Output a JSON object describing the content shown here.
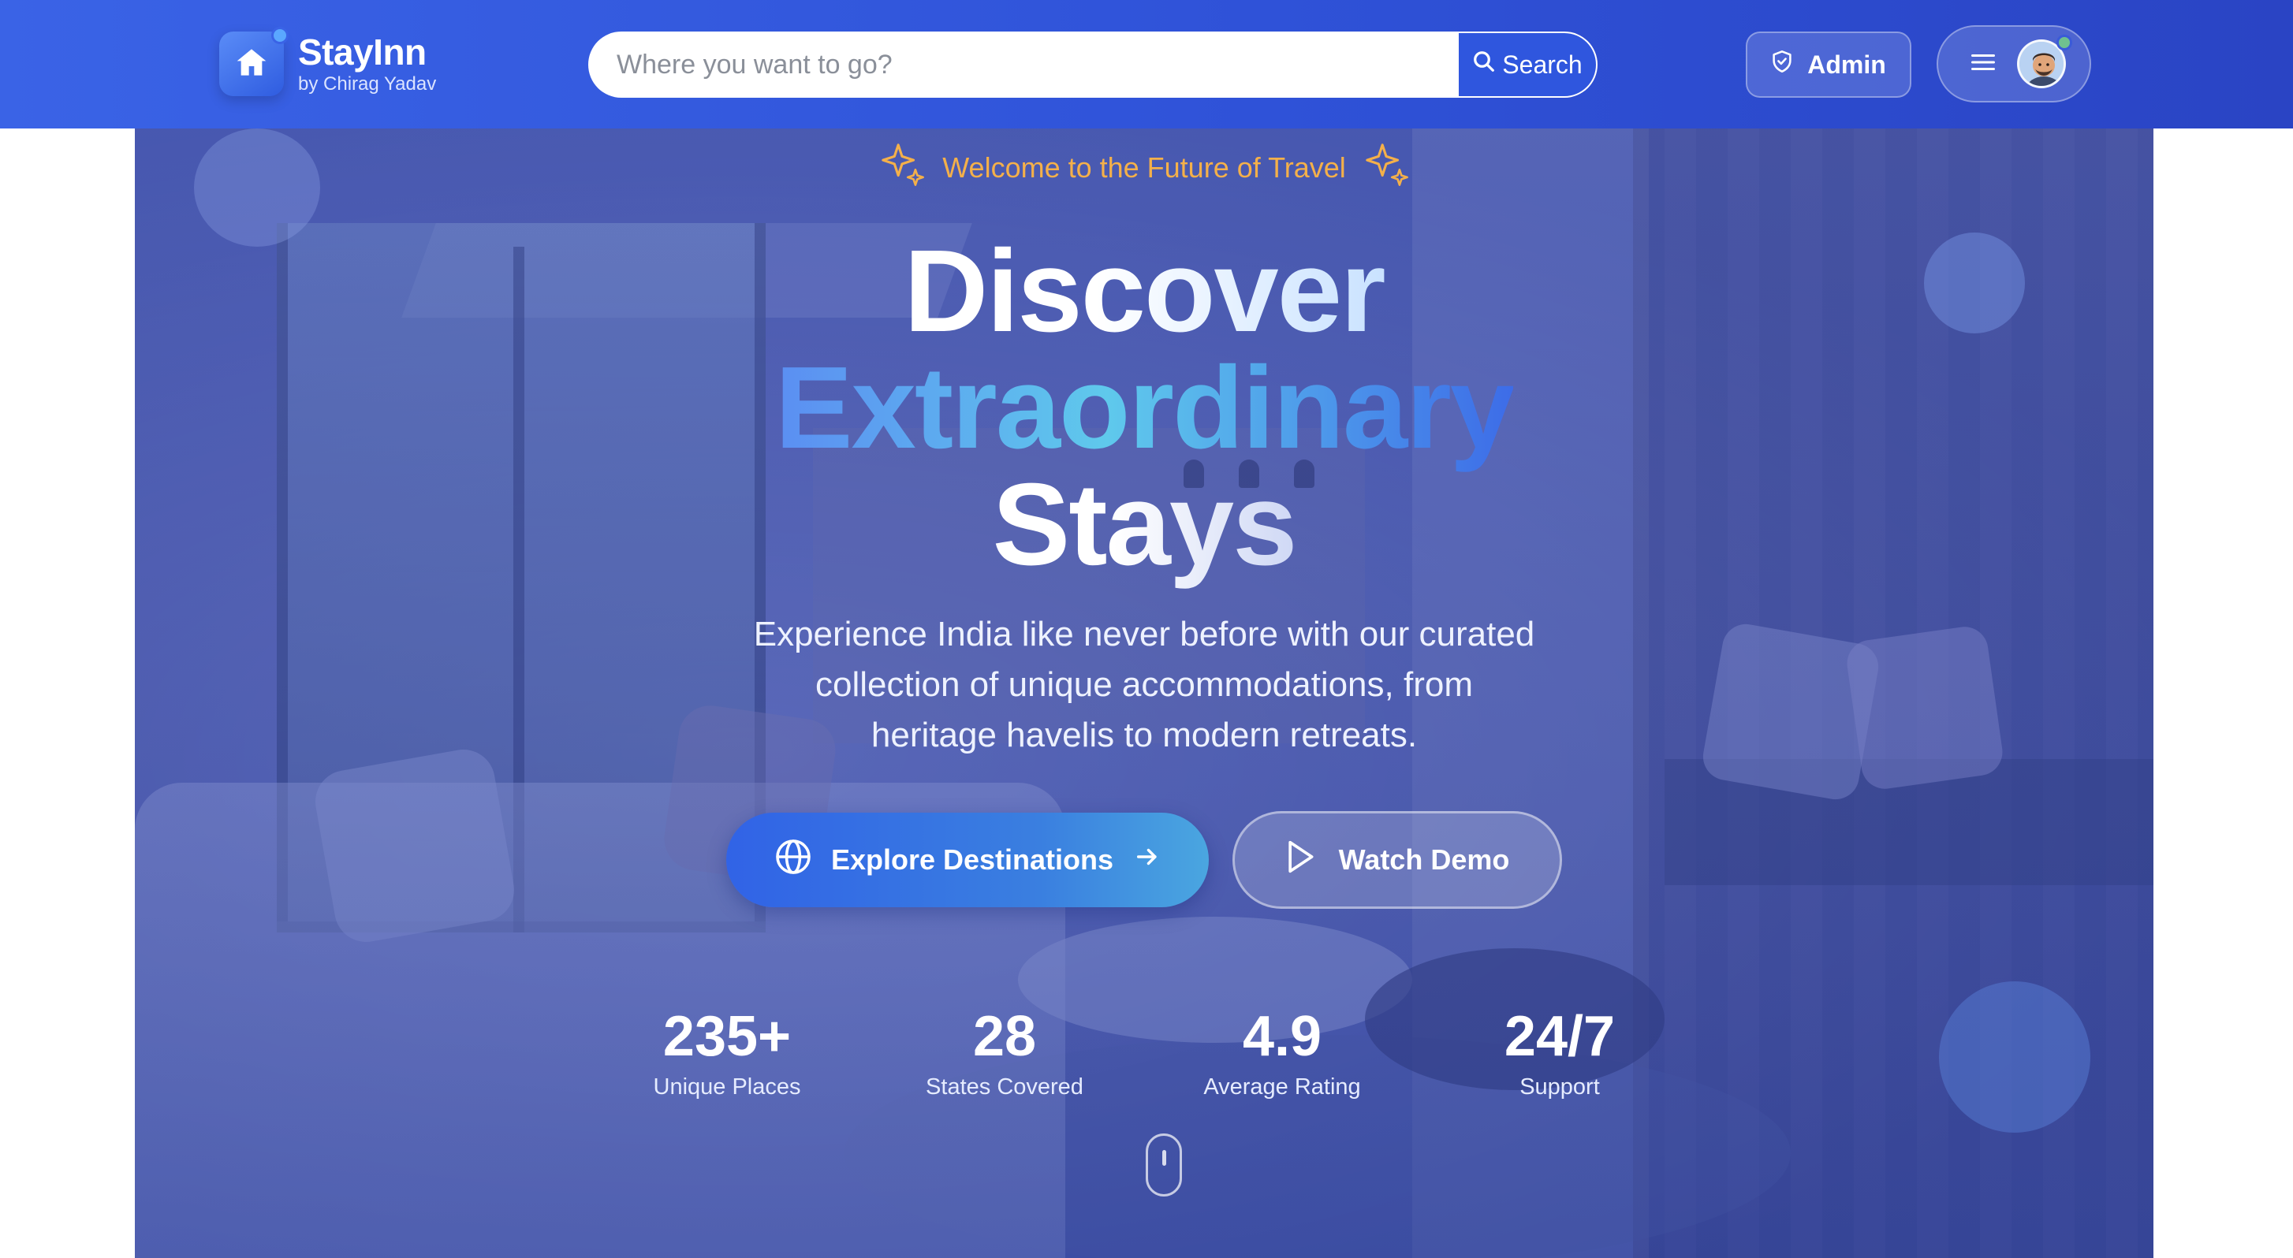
{
  "brand": {
    "name": "StayInn",
    "subtitle": "by Chirag Yadav",
    "logo_icon": "home-icon"
  },
  "search": {
    "placeholder": "Where you want to go?",
    "value": "",
    "button_label": "Search",
    "button_icon": "search-icon"
  },
  "nav": {
    "admin_label": "Admin",
    "admin_icon": "shield-icon",
    "menu_icon": "hamburger-icon",
    "avatar_icon": "avatar"
  },
  "hero": {
    "tagline": "Welcome to the Future of Travel",
    "title_line1": "Discover",
    "title_line2": "Extraordinary",
    "title_line3": "Stays",
    "description": "Experience India like never before with our curated collection of unique accommodations, from heritage havelis to modern retreats.",
    "primary_button": "Explore Destinations",
    "secondary_button": "Watch Demo"
  },
  "stats": [
    {
      "value": "235+",
      "label": "Unique Places"
    },
    {
      "value": "28",
      "label": "States Covered"
    },
    {
      "value": "4.9",
      "label": "Average Rating"
    },
    {
      "value": "24/7",
      "label": "Support"
    }
  ],
  "colors": {
    "nav_bg": "#3a63e6",
    "accent": "#2f56de",
    "tagline": "#f4b04a",
    "gradient_cyan": "#5fc9ec"
  }
}
